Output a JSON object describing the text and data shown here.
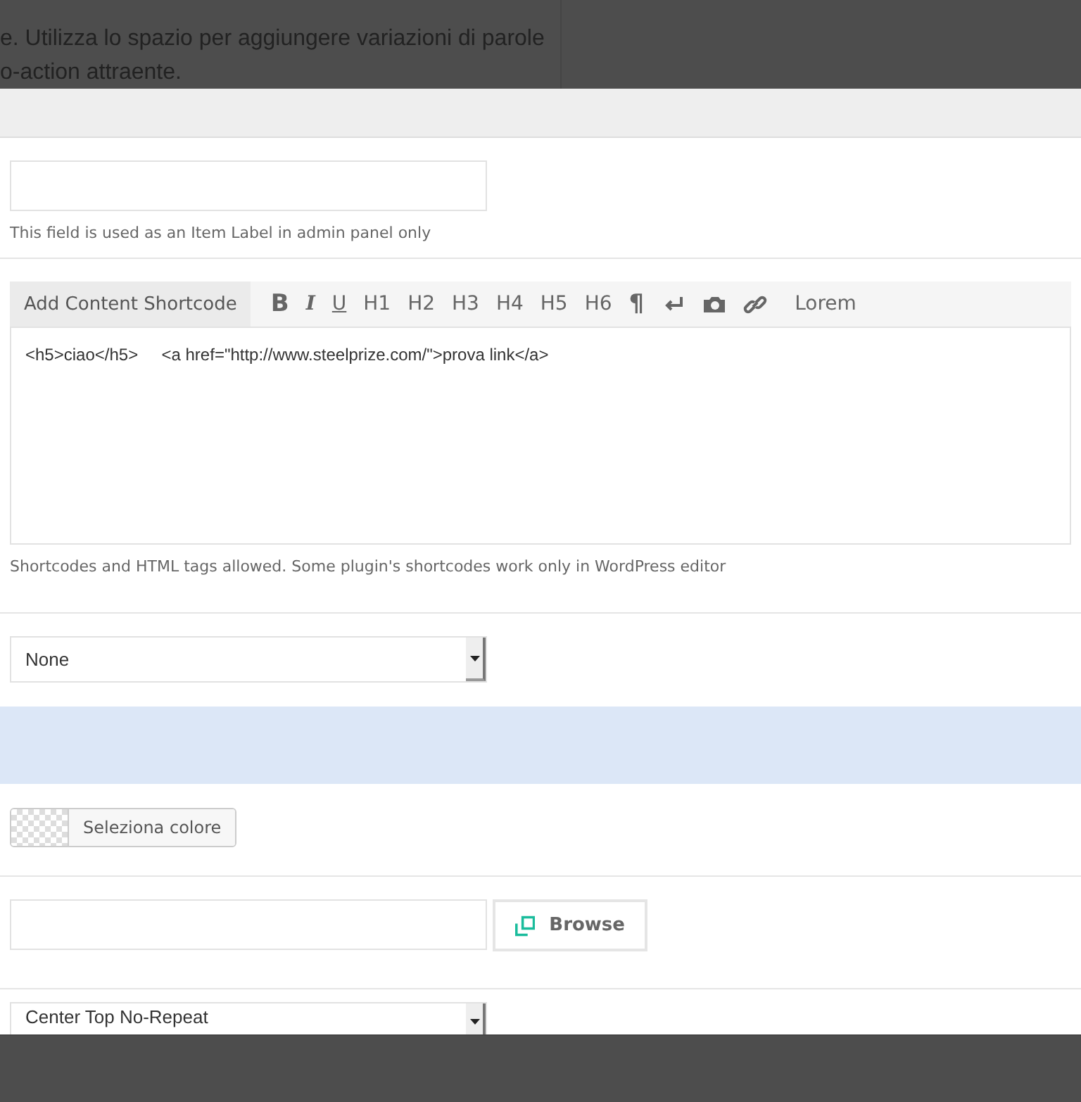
{
  "background_text": [
    "e. Utilizza lo spazio per aggiungere variazioni di parole",
    "o-action attraente."
  ],
  "label_field": {
    "hint": "This field is used as an Item Label in admin panel only"
  },
  "editor": {
    "shortcode_button": "Add Content Shortcode",
    "toolbar": [
      {
        "kind": "bold",
        "label": "B"
      },
      {
        "kind": "italic",
        "label": "I"
      },
      {
        "kind": "underline",
        "label": "U"
      },
      {
        "kind": "text",
        "label": "H1"
      },
      {
        "kind": "text",
        "label": "H2"
      },
      {
        "kind": "text",
        "label": "H3"
      },
      {
        "kind": "text",
        "label": "H4"
      },
      {
        "kind": "text",
        "label": "H5"
      },
      {
        "kind": "text",
        "label": "H6"
      },
      {
        "kind": "bold",
        "label": "¶"
      },
      {
        "kind": "return"
      },
      {
        "kind": "camera"
      },
      {
        "kind": "link"
      },
      {
        "kind": "text",
        "label": "Lorem"
      }
    ],
    "content": "<h5>ciao</h5>     <a href=\"http://www.steelprize.com/\">prova link</a>",
    "hint": "Shortcodes and HTML tags allowed. Some plugin's shortcodes work only in WordPress editor"
  },
  "select_1": {
    "value": "None"
  },
  "color_picker": {
    "button": "Seleziona colore"
  },
  "image_field": {
    "button": "Browse"
  },
  "select_2": {
    "value": "Center Top No-Repeat"
  }
}
